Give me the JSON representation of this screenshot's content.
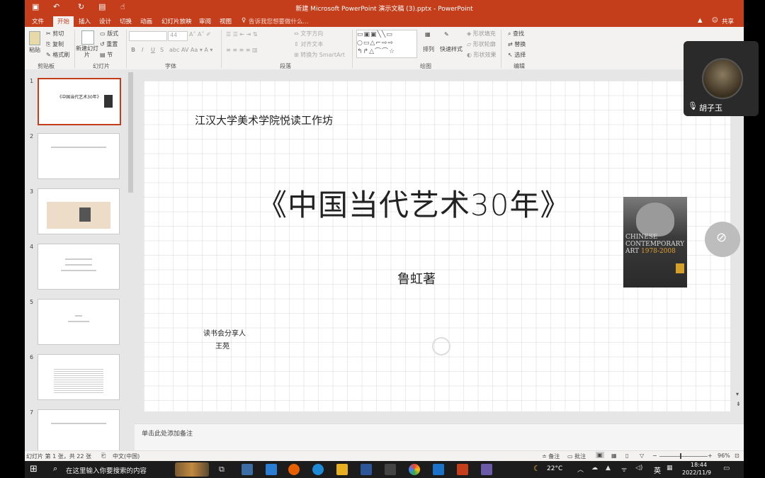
{
  "window": {
    "title": "新建 Microsoft PowerPoint 演示文稿 (3).pptx - PowerPoint"
  },
  "ribbon_tabs": [
    "文件",
    "开始",
    "插入",
    "设计",
    "切换",
    "动画",
    "幻灯片放映",
    "审阅",
    "视图"
  ],
  "tell_me": "告诉我您想要做什么...",
  "share_label": "共享",
  "ribbon": {
    "clipboard": {
      "paste": "粘贴",
      "cut": "剪切",
      "copy": "复制",
      "format_painter": "格式刷",
      "group": "剪贴板"
    },
    "slides": {
      "new_slide": "新建幻灯片",
      "layout": "版式",
      "reset": "重置",
      "section": "节",
      "group": "幻灯片"
    },
    "font": {
      "size": "44",
      "group": "字体"
    },
    "paragraph": {
      "text_direction": "文字方向",
      "align_text": "对齐文本",
      "smartart": "转换为 SmartArt",
      "group": "段落"
    },
    "drawing": {
      "arrange": "排列",
      "quick_styles": "快速样式",
      "shape_fill": "形状填充",
      "shape_outline": "形状轮廓",
      "shape_effects": "形状效果",
      "group": "绘图"
    },
    "editing": {
      "find": "查找",
      "replace": "替换",
      "select": "选择",
      "group": "编辑"
    }
  },
  "thumbnails": [
    {
      "num": "1",
      "title": "《中国当代艺术30年》"
    },
    {
      "num": "2",
      "title": ""
    },
    {
      "num": "3",
      "title": ""
    },
    {
      "num": "4",
      "title": ""
    },
    {
      "num": "5",
      "title": ""
    },
    {
      "num": "6",
      "title": ""
    },
    {
      "num": "7",
      "title": ""
    }
  ],
  "slide": {
    "org": "江汉大学美术学院悦读工作坊",
    "title": "《中国当代艺术30年》",
    "author": "鲁虹著",
    "presenter_label": "读书会分享人",
    "presenter_name": "王苑",
    "book_cover": {
      "line1": "CHINESE",
      "line2": "CONTEMPORARY",
      "line3": "ART",
      "years": "1978-2008"
    }
  },
  "notes_placeholder": "单击此处添加备注",
  "status": {
    "slide_info": "幻灯片 第 1 张，共 22 张",
    "language": "中文(中国)",
    "notes_btn": "备注",
    "comments_btn": "批注",
    "zoom": "96%"
  },
  "meeting": {
    "participant_name": "胡子玉"
  },
  "taskbar": {
    "search_placeholder": "在这里输入你要搜索的内容",
    "weather": "22°C",
    "ime": "英",
    "time": "18:44",
    "date": "2022/11/9"
  },
  "colors": {
    "accent": "#c43e1c",
    "taskbar": "#1c1c1c"
  }
}
